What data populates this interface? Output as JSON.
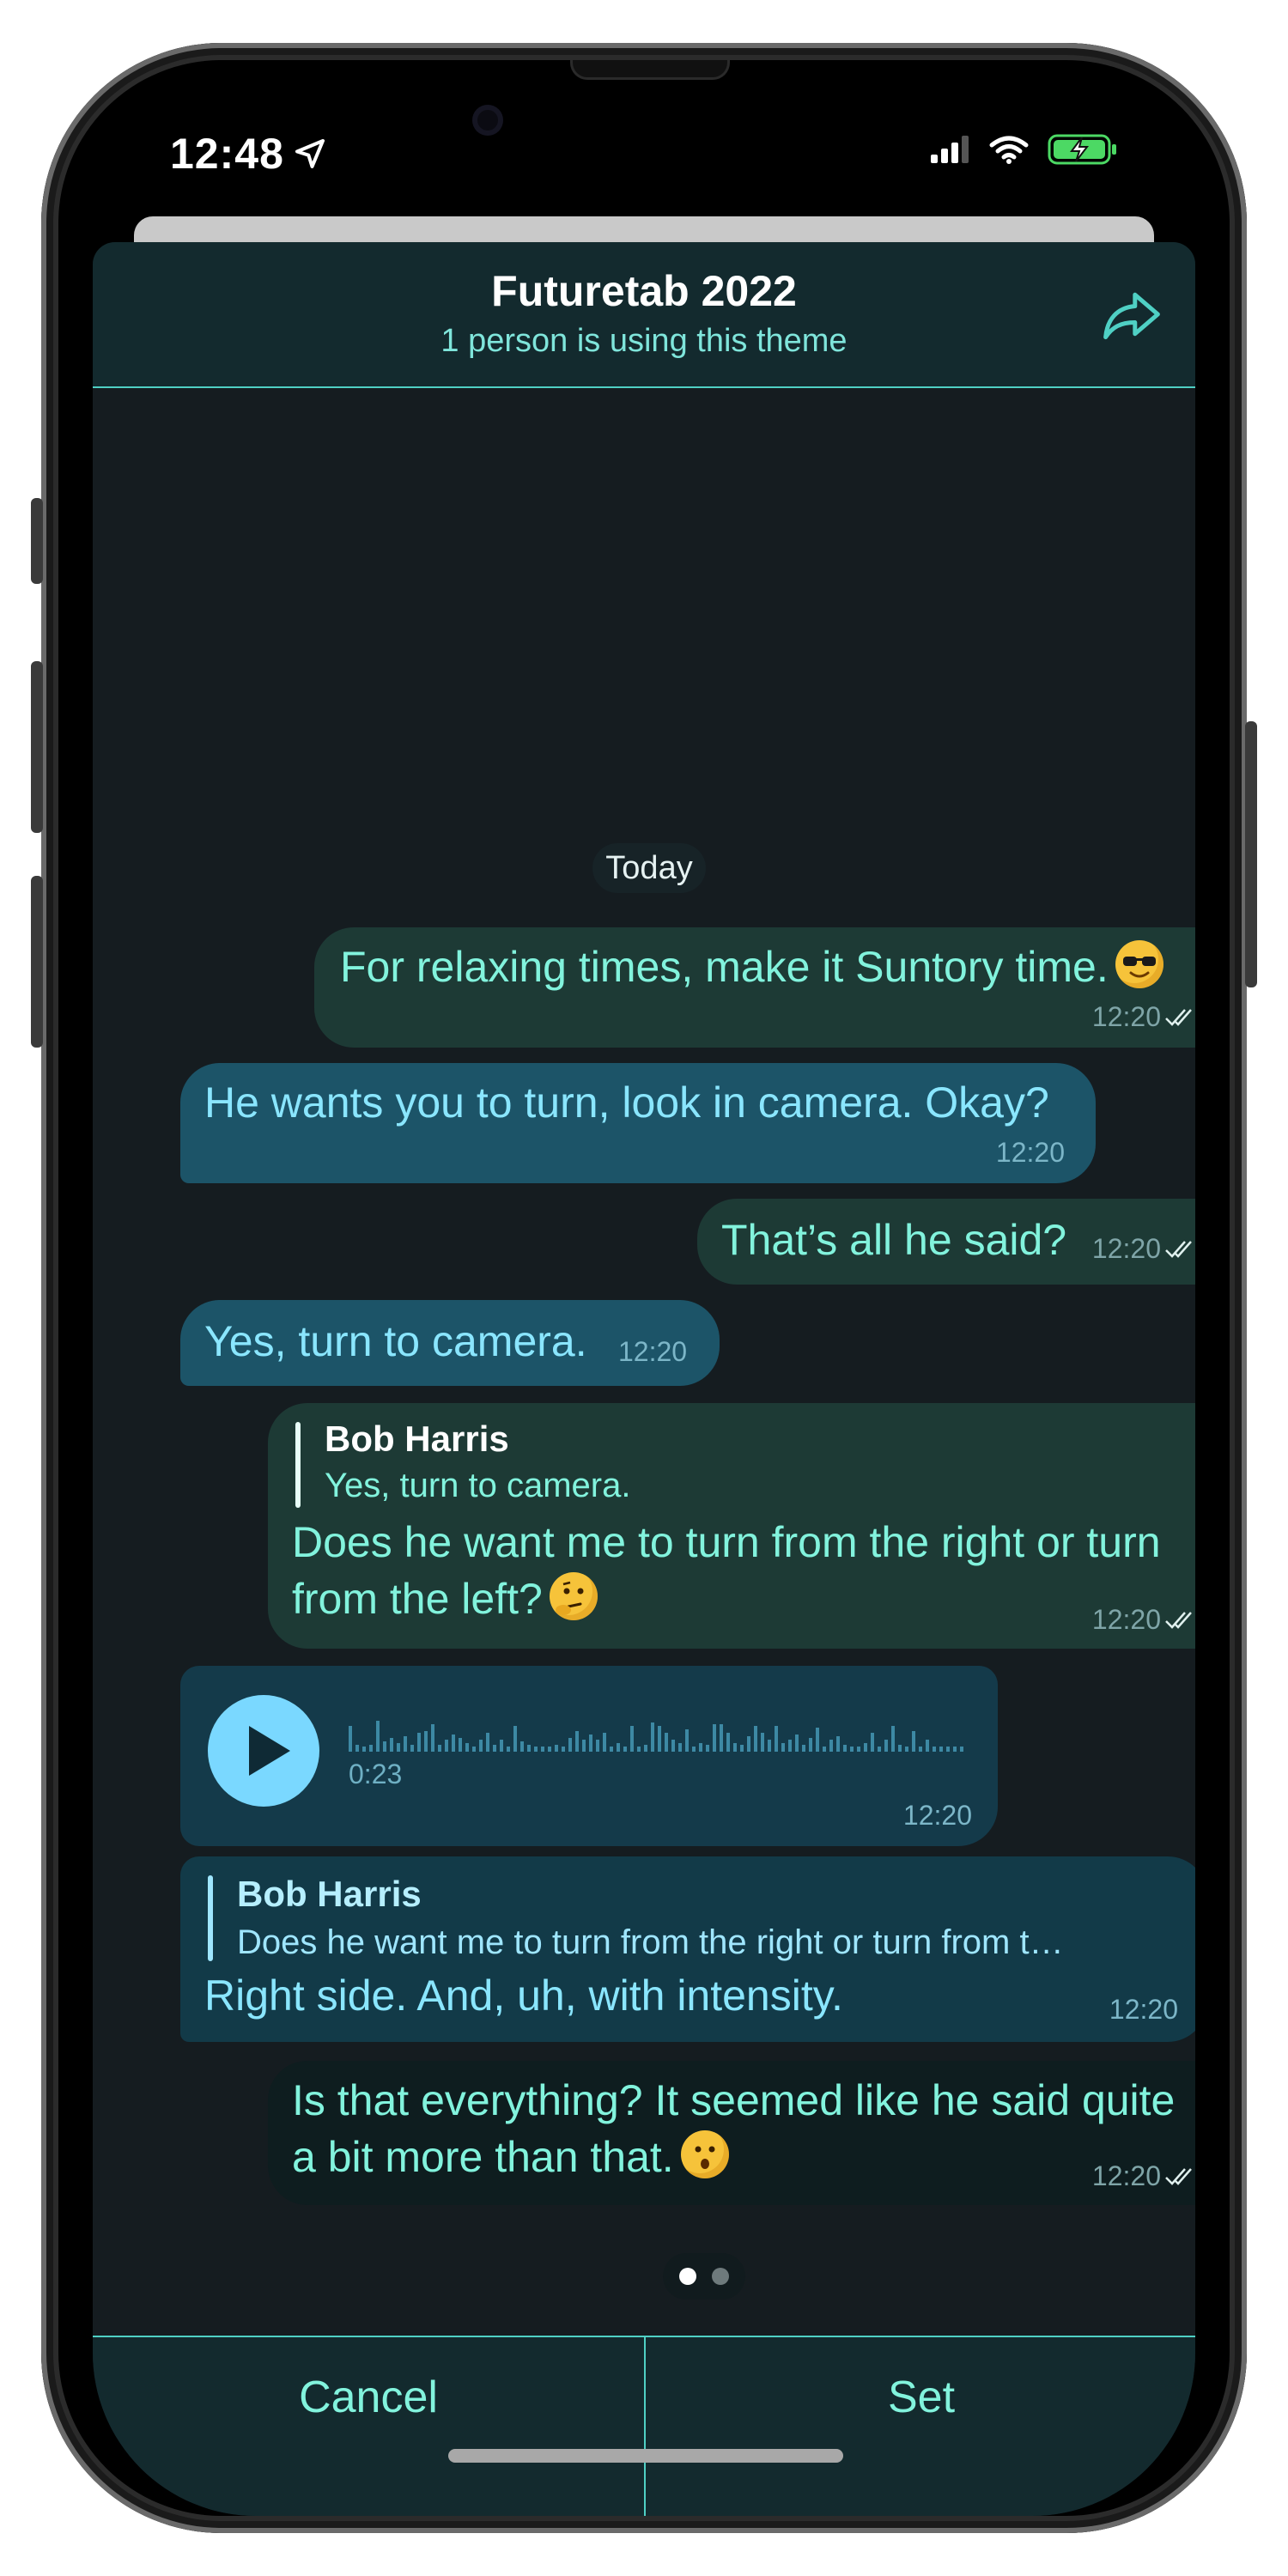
{
  "status_bar": {
    "time": "12:48"
  },
  "header": {
    "title": "Futuretab 2022",
    "subtitle": "1 person is using this theme"
  },
  "chat": {
    "date_label": "Today",
    "messages": [
      {
        "direction": "out",
        "text": "For relaxing times, make it Suntory time.",
        "emoji": "smiling-face-with-sunglasses",
        "time": "12:20"
      },
      {
        "direction": "in",
        "text": "He wants you to turn, look in camera. Okay?",
        "time": "12:20"
      },
      {
        "direction": "out",
        "text": "That’s all he said?",
        "time": "12:20"
      },
      {
        "direction": "in",
        "text": "Yes, turn to camera.",
        "time": "12:20"
      },
      {
        "direction": "out",
        "reply_name": "Bob Harris",
        "reply_text": "Yes, turn to camera.",
        "text_line1": "Does he want me to turn from the right or turn",
        "text_line2": "from the left?",
        "emoji": "thinking-face",
        "time": "12:20"
      },
      {
        "direction": "in",
        "type": "voice",
        "duration": "0:23",
        "time": "12:20"
      },
      {
        "direction": "in",
        "reply_name": "Bob Harris",
        "reply_text": "Does he want me to turn from the right or turn from t…",
        "text": "Right side. And, uh, with intensity.",
        "time": "12:20"
      },
      {
        "direction": "out",
        "text_line1": "Is that everything? It seemed like he said quite",
        "text_line2": "a bit more than that.",
        "emoji": "hushed-face",
        "time": "12:20"
      }
    ]
  },
  "footer": {
    "cancel_label": "Cancel",
    "set_label": "Set"
  },
  "colors": {
    "accent": "#4fd0c4",
    "out_text": "#82f3dd",
    "in_text": "#8ae6ff"
  },
  "icons": [
    "location-arrow-icon",
    "signal-icon",
    "wifi-icon",
    "battery-charging-icon",
    "share-icon",
    "double-check-icon",
    "play-icon"
  ]
}
